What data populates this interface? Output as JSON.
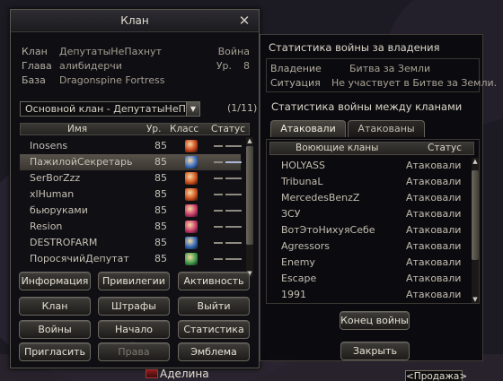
{
  "clan_window": {
    "title": "Клан",
    "info": {
      "clan_label": "Клан",
      "clan_value": "ДепутатыНеПахнут",
      "clan_extra": "Война",
      "leader_label": "Глава",
      "leader_value": "алибидерчи",
      "level_label": "Ур.",
      "level_value": "8",
      "base_label": "База",
      "base_value": "Dragonspine Fortress"
    },
    "clan_select": {
      "value": "Основной клан - ДепутатыНеПа"
    },
    "page_count": "(1/11)",
    "member_headers": {
      "name": "Имя",
      "level": "Ур.",
      "class": "Класс",
      "status": "Статус"
    },
    "members": [
      {
        "name": "Inosens",
        "level": "85",
        "class_icon": "fire-class-icon",
        "class_color": "#c8431a",
        "selected": false
      },
      {
        "name": "ПажилойСекретарь",
        "level": "85",
        "class_icon": "ice-class-icon",
        "class_color": "#3c6fc8",
        "selected": true
      },
      {
        "name": "SerBorZzz",
        "level": "85",
        "class_icon": "fire-class-icon",
        "class_color": "#d0501c",
        "selected": false
      },
      {
        "name": "xlHuman",
        "level": "85",
        "class_icon": "fire-class-icon",
        "class_color": "#d0501c",
        "selected": false
      },
      {
        "name": "бьюруками",
        "level": "85",
        "class_icon": "rose-class-icon",
        "class_color": "#c8386a",
        "selected": false
      },
      {
        "name": "Resion",
        "level": "85",
        "class_icon": "rose-class-icon",
        "class_color": "#c8386a",
        "selected": false
      },
      {
        "name": "DESTROFARM",
        "level": "85",
        "class_icon": "ice-class-icon",
        "class_color": "#2f66b8",
        "selected": false
      },
      {
        "name": "ПоросячийДепутат",
        "level": "85",
        "class_icon": "nature-class-icon",
        "class_color": "#3c9a4a",
        "selected": false
      }
    ],
    "buttons": {
      "info": "Информация",
      "privileges": "Привилегии",
      "activity": "Активность",
      "clan": "Клан",
      "fines": "Штрафы",
      "leave": "Выйти",
      "wars": "Войны",
      "start_war": "Начало войны",
      "stats": "Статистика",
      "invite": "Пригласить",
      "rights": "Права",
      "emblem": "Эмблема"
    }
  },
  "war_window": {
    "title_possession": "Статистика войны за владения",
    "possession_label": "Владение",
    "possession_value": "Битва за Земли",
    "situation_label": "Ситуация",
    "situation_value": "Не участвует в Битве за Земли.",
    "title_clans": "Статистика войны между кланами",
    "tabs": {
      "attacked": "Атаковали",
      "attacked_by": "Атакованы"
    },
    "headers": {
      "clans": "Воюющие кланы",
      "status": "Статус"
    },
    "wars": [
      {
        "clan": "HOLYASS",
        "status": "Атаковали"
      },
      {
        "clan": "TribunaL",
        "status": "Атаковали"
      },
      {
        "clan": "MercedesBenzZ",
        "status": "Атаковали"
      },
      {
        "clan": "ЗСУ",
        "status": "Атаковали"
      },
      {
        "clan": "ВотЭтоНихуяСебе",
        "status": "Атаковали"
      },
      {
        "clan": "Agressors",
        "status": "Атаковали"
      },
      {
        "clan": "Enemy",
        "status": "Атаковали"
      },
      {
        "clan": "Escape",
        "status": "Атаковали"
      },
      {
        "clan": "1991",
        "status": "Атаковали"
      }
    ],
    "end_war_button": "Конец войны",
    "close_button": "Закрыть"
  },
  "world": {
    "player_name": "Аделина",
    "sale_tag": "<Продажа>"
  }
}
